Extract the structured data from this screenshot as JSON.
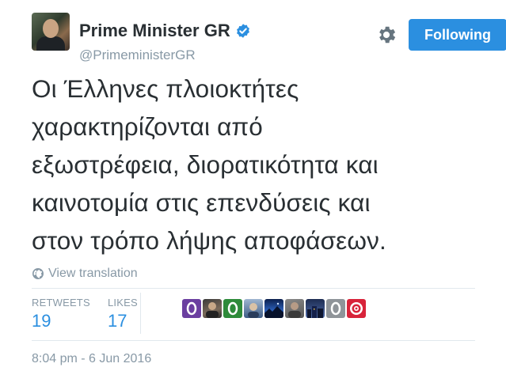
{
  "user": {
    "name": "Prime Minister GR",
    "handle": "@PrimeministerGR",
    "verified": true
  },
  "actions": {
    "follow_label": "Following",
    "settings_icon": "gear-icon"
  },
  "tweet": {
    "lines": [
      "Οι Έλληνες πλοιοκτήτες",
      "χαρακτηρίζονται από",
      "εξωστρέφεια, διορατικότητα και",
      "καινοτομία στις επενδύσεις και",
      "στον τρόπο λήψης αποφάσεων."
    ],
    "translate_label": "View translation",
    "timestamp": "8:04 pm - 6 Jun 2016"
  },
  "stats": {
    "retweets_label": "RETWEETS",
    "retweets_count": "19",
    "likes_label": "LIKES",
    "likes_count": "17"
  },
  "likers": [
    {
      "kind": "purple-o"
    },
    {
      "kind": "photo-dark"
    },
    {
      "kind": "green-o"
    },
    {
      "kind": "photo-blue"
    },
    {
      "kind": "night-sky"
    },
    {
      "kind": "photo-gray"
    },
    {
      "kind": "city"
    },
    {
      "kind": "gray-o"
    },
    {
      "kind": "target-red"
    }
  ],
  "colors": {
    "accent": "#2b8fe0",
    "muted": "#8899a6",
    "text": "#292f33"
  }
}
